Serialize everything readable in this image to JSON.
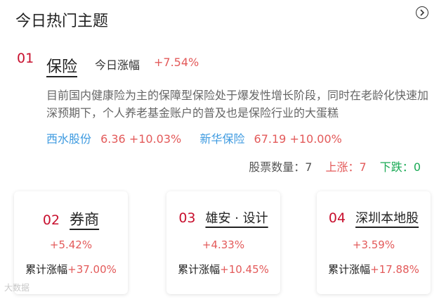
{
  "header": {
    "title": "今日热门主题",
    "icon": "chevron-right-circle-icon"
  },
  "featured": {
    "rank": "01",
    "name": "保险",
    "today_label": "今日涨幅",
    "today_pct": "+7.54%",
    "description": "目前国内健康险为主的保障型保险处于爆发性增长阶段，同时在老龄化快速加深预期下，个人养老基金账户的普及也是保险行业的大蛋糕",
    "stocks": [
      {
        "name": "西水股份",
        "price": "6.36",
        "change": "+10.03%"
      },
      {
        "name": "新华保险",
        "price": "67.19",
        "change": "+10.00%"
      }
    ],
    "counts": {
      "total_label": "股票数量：",
      "total": "7",
      "up_label": "上涨：",
      "up": "7",
      "down_label": "下跌：",
      "down": "0"
    }
  },
  "cards": [
    {
      "rank": "02",
      "name": "券商",
      "pct": "+5.42%",
      "cum_label": "累计涨幅",
      "cum_pct": "+37.00%"
    },
    {
      "rank": "03",
      "name": "雄安 · 设计",
      "pct": "+4.33%",
      "cum_label": "累计涨幅",
      "cum_pct": "+10.45%"
    },
    {
      "rank": "04",
      "name": "深圳本地股",
      "pct": "+3.59%",
      "cum_label": "累计涨幅",
      "cum_pct": "+17.88%"
    }
  ],
  "watermark": "大数据",
  "colors": {
    "rank": "#c8102e",
    "up": "#e35a5a",
    "down": "#1aaa55",
    "link": "#3d9ae0"
  }
}
